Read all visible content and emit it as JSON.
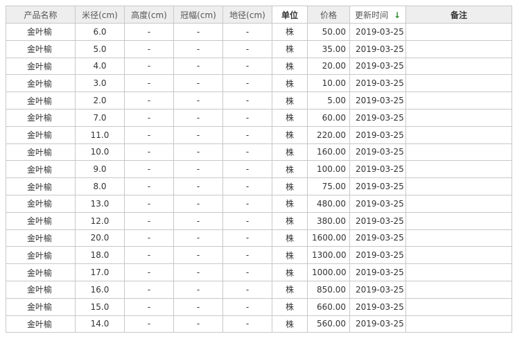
{
  "columns": {
    "name": "产品名称",
    "diameter": "米径(cm)",
    "height": "高度(cm)",
    "crown": "冠幅(cm)",
    "ground": "地径(cm)",
    "unit": "单位",
    "price": "价格",
    "updated": "更新时间",
    "note": "备注"
  },
  "sort_icon": "down-arrow-icon",
  "rows": [
    {
      "name": "金叶榆",
      "diameter": "6.0",
      "height": "-",
      "crown": "-",
      "ground": "-",
      "unit": "株",
      "price": "50.00",
      "updated": "2019-03-25",
      "note": ""
    },
    {
      "name": "金叶榆",
      "diameter": "5.0",
      "height": "-",
      "crown": "-",
      "ground": "-",
      "unit": "株",
      "price": "35.00",
      "updated": "2019-03-25",
      "note": ""
    },
    {
      "name": "金叶榆",
      "diameter": "4.0",
      "height": "-",
      "crown": "-",
      "ground": "-",
      "unit": "株",
      "price": "20.00",
      "updated": "2019-03-25",
      "note": ""
    },
    {
      "name": "金叶榆",
      "diameter": "3.0",
      "height": "-",
      "crown": "-",
      "ground": "-",
      "unit": "株",
      "price": "10.00",
      "updated": "2019-03-25",
      "note": ""
    },
    {
      "name": "金叶榆",
      "diameter": "2.0",
      "height": "-",
      "crown": "-",
      "ground": "-",
      "unit": "株",
      "price": "5.00",
      "updated": "2019-03-25",
      "note": ""
    },
    {
      "name": "金叶榆",
      "diameter": "7.0",
      "height": "-",
      "crown": "-",
      "ground": "-",
      "unit": "株",
      "price": "60.00",
      "updated": "2019-03-25",
      "note": ""
    },
    {
      "name": "金叶榆",
      "diameter": "11.0",
      "height": "-",
      "crown": "-",
      "ground": "-",
      "unit": "株",
      "price": "220.00",
      "updated": "2019-03-25",
      "note": ""
    },
    {
      "name": "金叶榆",
      "diameter": "10.0",
      "height": "-",
      "crown": "-",
      "ground": "-",
      "unit": "株",
      "price": "160.00",
      "updated": "2019-03-25",
      "note": ""
    },
    {
      "name": "金叶榆",
      "diameter": "9.0",
      "height": "-",
      "crown": "-",
      "ground": "-",
      "unit": "株",
      "price": "100.00",
      "updated": "2019-03-25",
      "note": ""
    },
    {
      "name": "金叶榆",
      "diameter": "8.0",
      "height": "-",
      "crown": "-",
      "ground": "-",
      "unit": "株",
      "price": "75.00",
      "updated": "2019-03-25",
      "note": ""
    },
    {
      "name": "金叶榆",
      "diameter": "13.0",
      "height": "-",
      "crown": "-",
      "ground": "-",
      "unit": "株",
      "price": "480.00",
      "updated": "2019-03-25",
      "note": ""
    },
    {
      "name": "金叶榆",
      "diameter": "12.0",
      "height": "-",
      "crown": "-",
      "ground": "-",
      "unit": "株",
      "price": "380.00",
      "updated": "2019-03-25",
      "note": ""
    },
    {
      "name": "金叶榆",
      "diameter": "20.0",
      "height": "-",
      "crown": "-",
      "ground": "-",
      "unit": "株",
      "price": "1600.00",
      "updated": "2019-03-25",
      "note": ""
    },
    {
      "name": "金叶榆",
      "diameter": "18.0",
      "height": "-",
      "crown": "-",
      "ground": "-",
      "unit": "株",
      "price": "1300.00",
      "updated": "2019-03-25",
      "note": ""
    },
    {
      "name": "金叶榆",
      "diameter": "17.0",
      "height": "-",
      "crown": "-",
      "ground": "-",
      "unit": "株",
      "price": "1000.00",
      "updated": "2019-03-25",
      "note": ""
    },
    {
      "name": "金叶榆",
      "diameter": "16.0",
      "height": "-",
      "crown": "-",
      "ground": "-",
      "unit": "株",
      "price": "850.00",
      "updated": "2019-03-25",
      "note": ""
    },
    {
      "name": "金叶榆",
      "diameter": "15.0",
      "height": "-",
      "crown": "-",
      "ground": "-",
      "unit": "株",
      "price": "660.00",
      "updated": "2019-03-25",
      "note": ""
    },
    {
      "name": "金叶榆",
      "diameter": "14.0",
      "height": "-",
      "crown": "-",
      "ground": "-",
      "unit": "株",
      "price": "560.00",
      "updated": "2019-03-25",
      "note": ""
    }
  ]
}
